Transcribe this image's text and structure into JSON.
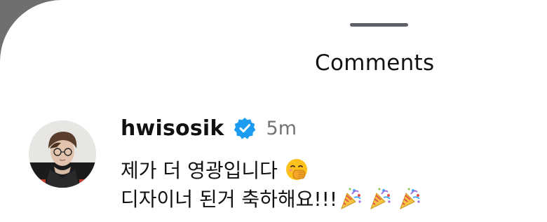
{
  "sheet": {
    "title": "Comments"
  },
  "comment": {
    "username": "hwisosik",
    "verified": true,
    "time": "5m",
    "line1": "제가 더 영광입니다",
    "line2": "디자이너 된거 축하해요!!!",
    "line1_emoji": "hand-over-mouth-emoji",
    "line2_emojis": [
      "party-popper-emoji",
      "party-popper-emoji",
      "party-popper-emoji"
    ]
  },
  "colors": {
    "verified_badge": "#1d9bf0",
    "time_text": "#737373",
    "handle": "#5e6168"
  }
}
